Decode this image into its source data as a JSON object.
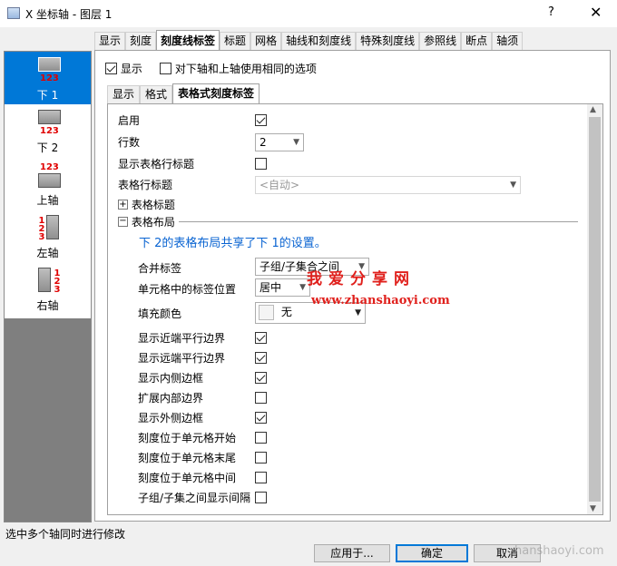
{
  "window": {
    "title": "X 坐标轴 - 图层 1",
    "help": "?",
    "close": "✕"
  },
  "tabs": [
    "显示",
    "刻度",
    "刻度线标签",
    "标题",
    "网格",
    "轴线和刻度线",
    "特殊刻度线",
    "参照线",
    "断点",
    "轴须"
  ],
  "active_tab": 2,
  "left_list": [
    {
      "label": "下 1",
      "glyph": "bottom-axis-icon",
      "digits": "123"
    },
    {
      "label": "下 2",
      "glyph": "bottom-axis-icon",
      "digits": "123"
    },
    {
      "label": "上轴",
      "glyph": "top-axis-icon",
      "digits": "123"
    },
    {
      "label": "左轴",
      "glyph": "left-axis-icon",
      "digits": "123"
    },
    {
      "label": "右轴",
      "glyph": "right-axis-icon",
      "digits": "123"
    }
  ],
  "top_options": {
    "show": "显示",
    "same_options": "对下轴和上轴使用相同的选项"
  },
  "subtabs": [
    "显示",
    "格式",
    "表格式刻度标签"
  ],
  "fields": {
    "enable": "启用",
    "rows": "行数",
    "rows_value": "2",
    "show_row_header": "显示表格行标题",
    "row_header": "表格行标题",
    "row_header_value": "<自动>",
    "table_title": "表格标题",
    "table_layout": "表格布局",
    "layout_note": "下 2的表格布局共享了下 1的设置。",
    "merge_label": "合并标签",
    "merge_value": "子组/子集合之间",
    "label_pos": "单元格中的标签位置",
    "label_pos_value": "居中",
    "fill_color": "填充颜色",
    "fill_value": "无"
  },
  "checkbox_rows": [
    {
      "label": "显示近端平行边界",
      "checked": true
    },
    {
      "label": "显示远端平行边界",
      "checked": true
    },
    {
      "label": "显示内侧边框",
      "checked": true
    },
    {
      "label": "扩展内部边界",
      "checked": false
    },
    {
      "label": "显示外侧边框",
      "checked": true
    },
    {
      "label": "刻度位于单元格开始",
      "checked": false
    },
    {
      "label": "刻度位于单元格末尾",
      "checked": false
    },
    {
      "label": "刻度位于单元格中间",
      "checked": false
    },
    {
      "label": "子组/子集之间显示间隔",
      "checked": false
    }
  ],
  "status": "选中多个轴同时进行修改",
  "buttons": {
    "apply": "应用于...",
    "ok": "确定",
    "cancel": "取消"
  },
  "watermark": {
    "line1": "我爱分享网",
    "line2": "www.zhanshaoyi.com",
    "line3": "hanshaoyi.com"
  },
  "colors": {
    "selection": "#0078d7",
    "note_blue": "#0a64d2",
    "watermark_red": "#e0201c"
  }
}
